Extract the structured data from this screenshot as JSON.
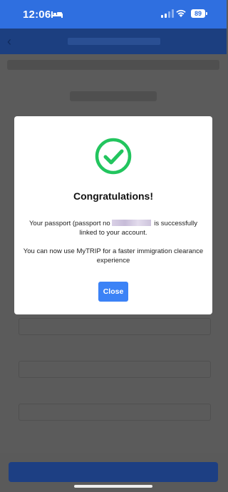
{
  "status_bar": {
    "time": "12:06",
    "battery": "89"
  },
  "modal": {
    "title": "Congratulations!",
    "message_before": "Your passport (passport no",
    "message_after": " is successfully linked to your account.",
    "message2": "You can now use MyTRIP for a faster immigration clearance experience",
    "close_label": "Close"
  },
  "colors": {
    "accent": "#3b82f6",
    "success": "#22c55e",
    "header": "#2f6fe0"
  }
}
